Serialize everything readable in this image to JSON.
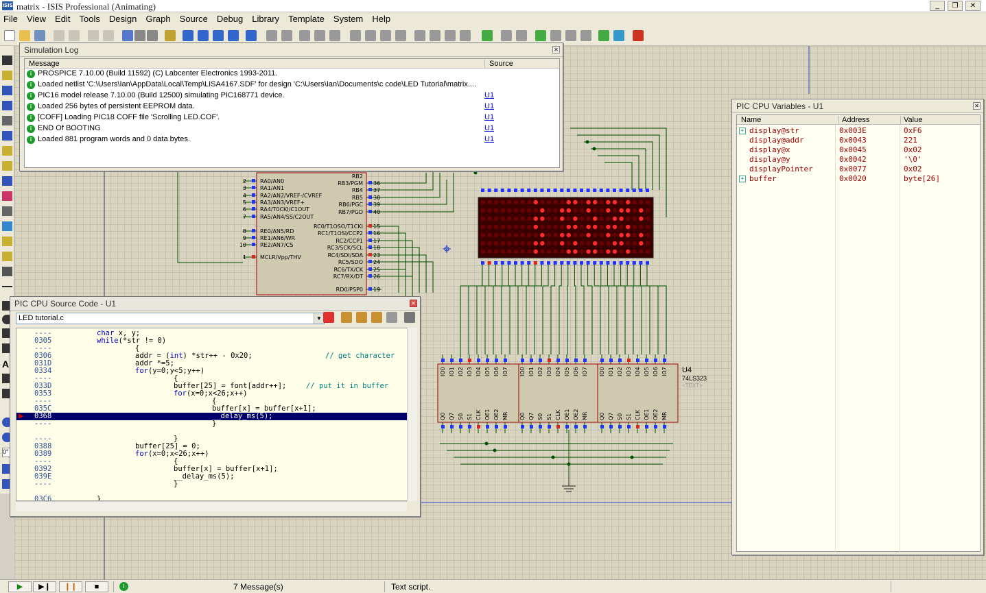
{
  "window": {
    "title": "matrix - ISIS Professional (Animating)",
    "app_icon": "ISIS",
    "controls": [
      "minimize",
      "restore",
      "close"
    ]
  },
  "menu": [
    "File",
    "View",
    "Edit",
    "Tools",
    "Design",
    "Graph",
    "Source",
    "Debug",
    "Library",
    "Template",
    "System",
    "Help"
  ],
  "simulation_log": {
    "title": "Simulation Log",
    "columns": [
      "Message",
      "Source"
    ],
    "rows": [
      {
        "message": "PROSPICE 7.10.00 (Build 11592) (C) Labcenter Electronics 1993-2011.",
        "source": ""
      },
      {
        "message": "Loaded netlist 'C:\\Users\\Ian\\AppData\\Local\\Temp\\LISA4167.SDF' for design 'C:\\Users\\Ian\\Documents\\c code\\LED Tutorial\\matrix....",
        "source": ""
      },
      {
        "message": "PIC16 model release 7.10.00 (Build 12500) simulating PIC168771 device.",
        "source": "U1"
      },
      {
        "message": "Loaded 256 bytes of persistent EEPROM data.",
        "source": "U1"
      },
      {
        "message": "[COFF] Loading PIC18 COFF file 'Scrolling LED.COF'.",
        "source": "U1"
      },
      {
        "message": "END Of BOOTING",
        "source": "U1"
      },
      {
        "message": "Loaded 881 program words and 0 data bytes.",
        "source": "U1"
      }
    ]
  },
  "cpu_variables": {
    "title": "PIC CPU Variables - U1",
    "columns": [
      "Name",
      "Address",
      "Value"
    ],
    "rows": [
      {
        "name": "display@str",
        "address": "0x003E",
        "value": "0xF6",
        "expandable": true
      },
      {
        "name": "display@addr",
        "address": "0x0043",
        "value": "221",
        "expandable": false
      },
      {
        "name": "display@x",
        "address": "0x0045",
        "value": "0x02",
        "expandable": false
      },
      {
        "name": "display@y",
        "address": "0x0042",
        "value": "'\\0'",
        "expandable": false
      },
      {
        "name": "displayPointer",
        "address": "0x0077",
        "value": "0x02",
        "expandable": false
      },
      {
        "name": "buffer",
        "address": "0x0020",
        "value": "byte[26]",
        "expandable": true
      }
    ]
  },
  "source_code": {
    "title": "PIC CPU Source Code - U1",
    "file": "LED tutorial.c",
    "lines": [
      {
        "addr": "----",
        "text": "char x, y;",
        "indent": 0
      },
      {
        "addr": "0305",
        "text": "while(*str != 0)",
        "indent": 0
      },
      {
        "addr": "----",
        "text": "{",
        "indent": 1
      },
      {
        "addr": "0306",
        "text": "addr = (int) *str++ - 0x20;",
        "indent": 1,
        "comment": "// get character"
      },
      {
        "addr": "031D",
        "text": "addr *=5;",
        "indent": 1
      },
      {
        "addr": "0334",
        "text": "for(y=0;y<5;y++)",
        "indent": 1
      },
      {
        "addr": "----",
        "text": "{",
        "indent": 2
      },
      {
        "addr": "033D",
        "text": "buffer[25] = font[addr++];",
        "indent": 2,
        "comment": "// put it in buffer"
      },
      {
        "addr": "0353",
        "text": "for(x=0;x<26;x++)",
        "indent": 2
      },
      {
        "addr": "----",
        "text": "{",
        "indent": 3
      },
      {
        "addr": "035C",
        "text": "buffer[x] = buffer[x+1];",
        "indent": 3
      },
      {
        "addr": "0368",
        "text": "__delay_ms(5);",
        "indent": 3,
        "current": true
      },
      {
        "addr": "----",
        "text": "}",
        "indent": 3
      },
      {
        "addr": "",
        "text": "",
        "indent": 0
      },
      {
        "addr": "----",
        "text": "}",
        "indent": 2
      },
      {
        "addr": "0388",
        "text": "buffer[25] = 0;",
        "indent": 1
      },
      {
        "addr": "0389",
        "text": "for(x=0;x<26;x++)",
        "indent": 1
      },
      {
        "addr": "----",
        "text": "{",
        "indent": 2
      },
      {
        "addr": "0392",
        "text": "buffer[x] = buffer[x+1];",
        "indent": 2
      },
      {
        "addr": "039E",
        "text": "__delay_ms(5);",
        "indent": 2
      },
      {
        "addr": "----",
        "text": "}",
        "indent": 2
      },
      {
        "addr": "",
        "text": "",
        "indent": 0
      },
      {
        "addr": "03C6",
        "text": "}",
        "indent": 0
      }
    ]
  },
  "schematic": {
    "mcu_left_pins": [
      {
        "num": "2",
        "name": "RA0/AN0"
      },
      {
        "num": "3",
        "name": "RA1/AN1"
      },
      {
        "num": "4",
        "name": "RA2/AN2/VREF-/CVREF"
      },
      {
        "num": "5",
        "name": "RA3/AN3/VREF+"
      },
      {
        "num": "6",
        "name": "RA4/T0CKI/C1OUT"
      },
      {
        "num": "7",
        "name": "RA5/AN4/SS/C2OUT"
      },
      {
        "num": "8",
        "name": "RE0/AN5/RD"
      },
      {
        "num": "9",
        "name": "RE1/AN6/WR"
      },
      {
        "num": "10",
        "name": "RE2/AN7/CS"
      },
      {
        "num": "1",
        "name": "MCLR/Vpp/THV"
      }
    ],
    "mcu_right_pins": [
      {
        "num": "36",
        "name": "RB3/PGM"
      },
      {
        "num": "37",
        "name": "RB4"
      },
      {
        "num": "38",
        "name": "RB5"
      },
      {
        "num": "39",
        "name": "RB6/PGC"
      },
      {
        "num": "40",
        "name": "RB7/PGD"
      },
      {
        "num": "15",
        "name": "RC0/T1OSO/T1CKI"
      },
      {
        "num": "16",
        "name": "RC1/T1OSI/CCP2"
      },
      {
        "num": "17",
        "name": "RC2/CCP1"
      },
      {
        "num": "18",
        "name": "RC3/SCK/SCL"
      },
      {
        "num": "23",
        "name": "RC4/SDI/SDA"
      },
      {
        "num": "24",
        "name": "RC5/SDO"
      },
      {
        "num": "25",
        "name": "RC6/TX/CK"
      },
      {
        "num": "26",
        "name": "RC7/RX/DT"
      },
      {
        "num": "19",
        "name": "RD0/PSP0"
      }
    ],
    "shift_register": {
      "ref": "U4",
      "part": "74LS323",
      "text": "<TEXT>"
    },
    "sr_top_pins": [
      "IO0",
      "IO1",
      "IO2",
      "IO3",
      "IO4",
      "IO5",
      "IO6",
      "IO7"
    ],
    "sr_bottom_pins": [
      "Q0",
      "Q7",
      "S0",
      "S1",
      "CLK",
      "OE1",
      "OE2",
      "MR"
    ],
    "rb_partial": "RB2"
  },
  "statusbar": {
    "buttons": [
      "play",
      "step",
      "pause",
      "stop"
    ],
    "messages": "7 Message(s)",
    "text": "Text script."
  },
  "colors": {
    "wire": "#005000",
    "led_on": "#ff2a2a",
    "led_off": "#6a0000",
    "led_bg": "#3a0000",
    "pin_blue": "#2233ff",
    "pin_red": "#dd2222",
    "chip_fill": "#cfc9b0",
    "chip_border": "#a00000",
    "current_line": "#00006a",
    "variable_text": "#a00000"
  }
}
